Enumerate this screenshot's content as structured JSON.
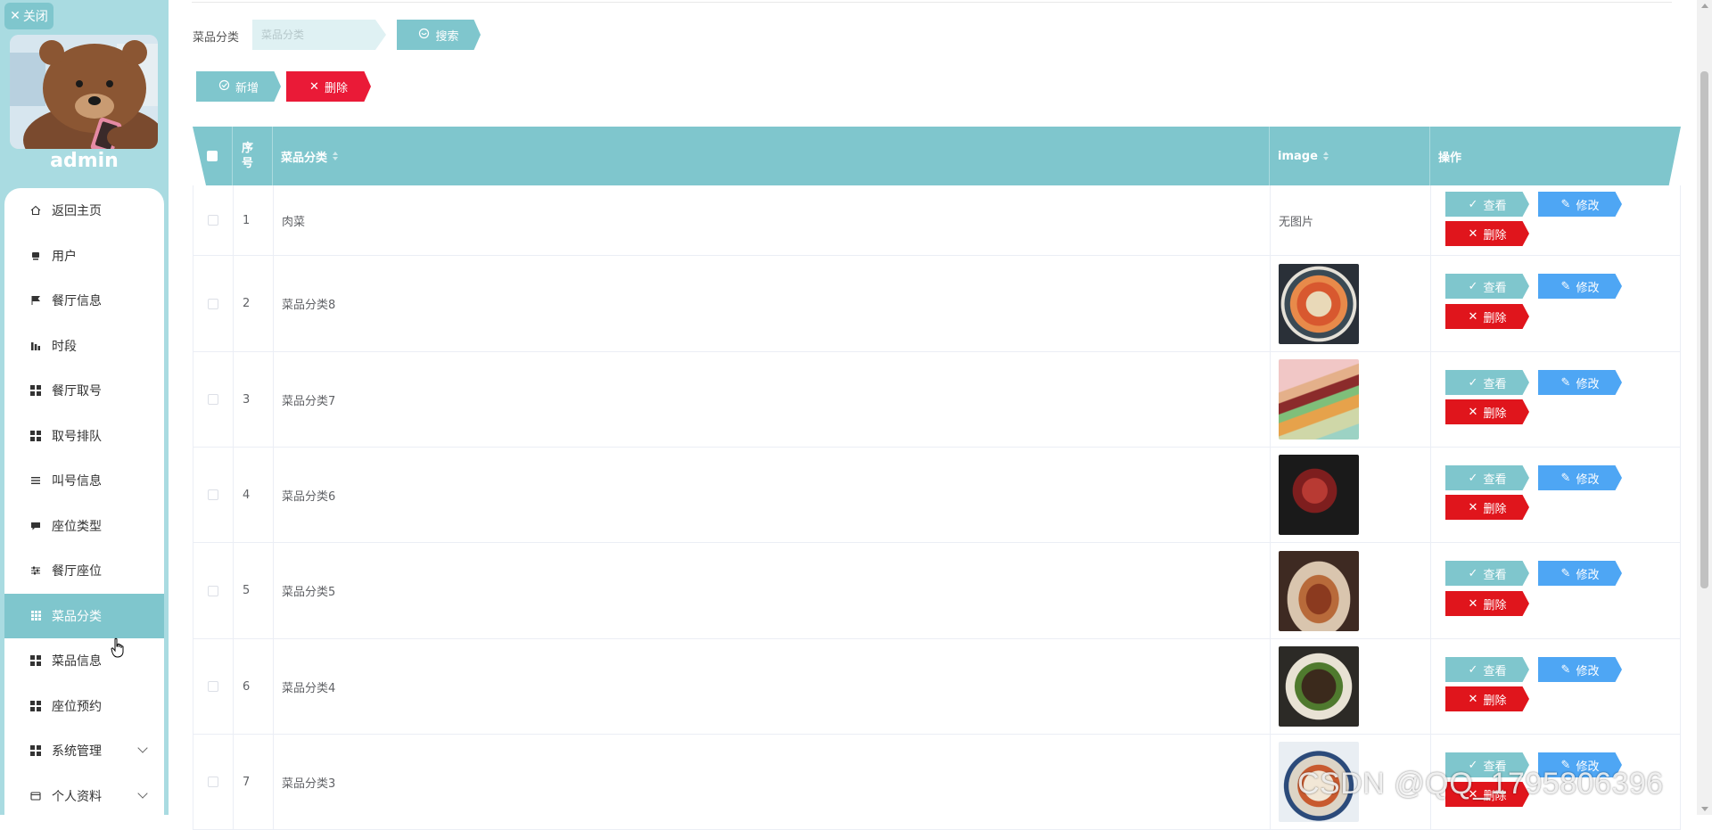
{
  "sidebar": {
    "close_label": "关闭",
    "username": "admin",
    "items": [
      {
        "label": "返回主页",
        "icon": "home-icon"
      },
      {
        "label": "用户",
        "icon": "user-icon"
      },
      {
        "label": "餐厅信息",
        "icon": "flag-icon"
      },
      {
        "label": "时段",
        "icon": "chart-icon"
      },
      {
        "label": "餐厅取号",
        "icon": "grid-icon"
      },
      {
        "label": "取号排队",
        "icon": "grid-icon"
      },
      {
        "label": "叫号信息",
        "icon": "list-icon"
      },
      {
        "label": "座位类型",
        "icon": "comment-icon"
      },
      {
        "label": "餐厅座位",
        "icon": "sliders-icon"
      },
      {
        "label": "菜品分类",
        "icon": "grid9-icon"
      },
      {
        "label": "菜品信息",
        "icon": "grid-icon"
      },
      {
        "label": "座位预约",
        "icon": "grid-icon"
      },
      {
        "label": "系统管理",
        "icon": "grid-icon"
      },
      {
        "label": "个人资料",
        "icon": "card-icon"
      }
    ]
  },
  "search": {
    "label": "菜品分类",
    "placeholder": "菜品分类",
    "button_label": "搜索"
  },
  "actions": {
    "add_label": "新增",
    "delete_label": "删除"
  },
  "table": {
    "columns": {
      "index": "序号",
      "category": "菜品分类",
      "image": "image",
      "ops": "操作"
    },
    "op_labels": {
      "view": "查看",
      "edit": "修改",
      "delete": "删除"
    },
    "no_image_text": "无图片",
    "rows": [
      {
        "index": "1",
        "category": "肉菜",
        "image": ""
      },
      {
        "index": "2",
        "category": "菜品分类8",
        "image": "shrimp-dish"
      },
      {
        "index": "3",
        "category": "菜品分类7",
        "image": "burger"
      },
      {
        "index": "4",
        "category": "菜品分类6",
        "image": "red-dish"
      },
      {
        "index": "5",
        "category": "菜品分类5",
        "image": "braised-dish"
      },
      {
        "index": "6",
        "category": "菜品分类4",
        "image": "stir-fry"
      },
      {
        "index": "7",
        "category": "菜品分类3",
        "image": "rice-bowl"
      }
    ]
  },
  "watermark": "CSDN @QQ_1795806396",
  "colors": {
    "accent": "#7fc6cd",
    "sidebar_bg": "#a9dbe1",
    "danger": "#ea1a37",
    "edit": "#4ea6f4"
  }
}
